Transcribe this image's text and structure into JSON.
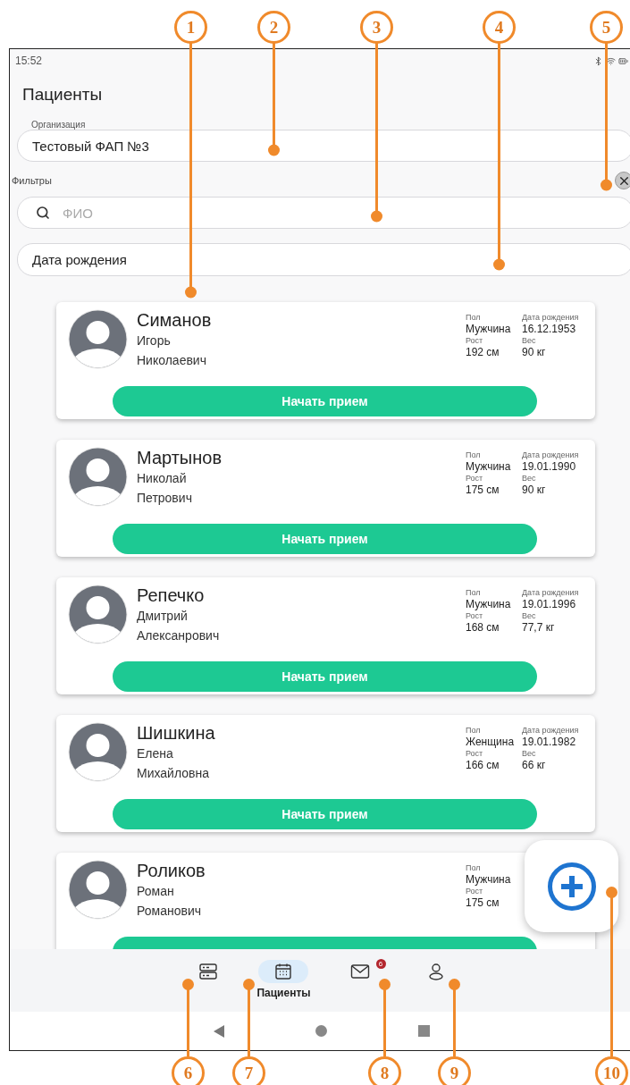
{
  "status_bar": {
    "time": "15:52"
  },
  "title": "Пациенты",
  "organization": {
    "label": "Организация",
    "value": "Тестовый ФАП №3"
  },
  "filters": {
    "label": "Фильтры",
    "search": {
      "placeholder": "ФИО"
    },
    "birth_date": {
      "placeholder": "Дата рождения"
    }
  },
  "patients": [
    {
      "last_name": "Симанов",
      "first_name": "Игорь",
      "patronymic": "Николаевич",
      "columns": [
        [
          {
            "label": "Пол",
            "value": "Мужчина"
          },
          {
            "label": "Рост",
            "value": "192 см"
          }
        ],
        [
          {
            "label": "Дата рождения",
            "value": "16.12.1953"
          },
          {
            "label": "Вес",
            "value": "90 кг"
          }
        ]
      ],
      "action": "Начать прием"
    },
    {
      "last_name": "Мартынов",
      "first_name": "Николай",
      "patronymic": "Петрович",
      "columns": [
        [
          {
            "label": "Пол",
            "value": "Мужчина"
          },
          {
            "label": "Рост",
            "value": "175 см"
          }
        ],
        [
          {
            "label": "Дата рождения",
            "value": "19.01.1990"
          },
          {
            "label": "Вес",
            "value": "90 кг"
          }
        ]
      ],
      "action": "Начать прием"
    },
    {
      "last_name": "Репечко",
      "first_name": "Дмитрий",
      "patronymic": "Алексанрович",
      "columns": [
        [
          {
            "label": "Пол",
            "value": "Мужчина"
          },
          {
            "label": "Рост",
            "value": "168 см"
          }
        ],
        [
          {
            "label": "Дата рождения",
            "value": "19.01.1996"
          },
          {
            "label": "Вес",
            "value": "77,7 кг"
          }
        ]
      ],
      "action": "Начать прием"
    },
    {
      "last_name": "Шишкина",
      "first_name": "Елена",
      "patronymic": "Михайловна",
      "columns": [
        [
          {
            "label": "Пол",
            "value": "Женщина"
          },
          {
            "label": "Рост",
            "value": "166 см"
          }
        ],
        [
          {
            "label": "Дата рождения",
            "value": "19.01.1982"
          },
          {
            "label": "Вес",
            "value": "66 кг"
          }
        ]
      ],
      "action": "Начать прием"
    },
    {
      "last_name": "Роликов",
      "first_name": "Роман",
      "patronymic": "Романович",
      "columns": [
        [
          {
            "label": "Пол",
            "value": "Мужчина"
          },
          {
            "label": "Рост",
            "value": "175 см"
          }
        ]
      ]
    }
  ],
  "nav": [
    {
      "kind": "list",
      "selected": false
    },
    {
      "kind": "calendar",
      "label": "Пациенты",
      "selected": true
    },
    {
      "kind": "mail",
      "badge": "6",
      "selected": false
    },
    {
      "kind": "profile",
      "selected": false
    }
  ],
  "callouts": [
    {
      "label": "1"
    },
    {
      "label": "2"
    },
    {
      "label": "3"
    },
    {
      "label": "4"
    },
    {
      "label": "5"
    },
    {
      "label": "6"
    },
    {
      "label": "7"
    },
    {
      "label": "8"
    },
    {
      "label": "9"
    },
    {
      "label": "10"
    }
  ]
}
